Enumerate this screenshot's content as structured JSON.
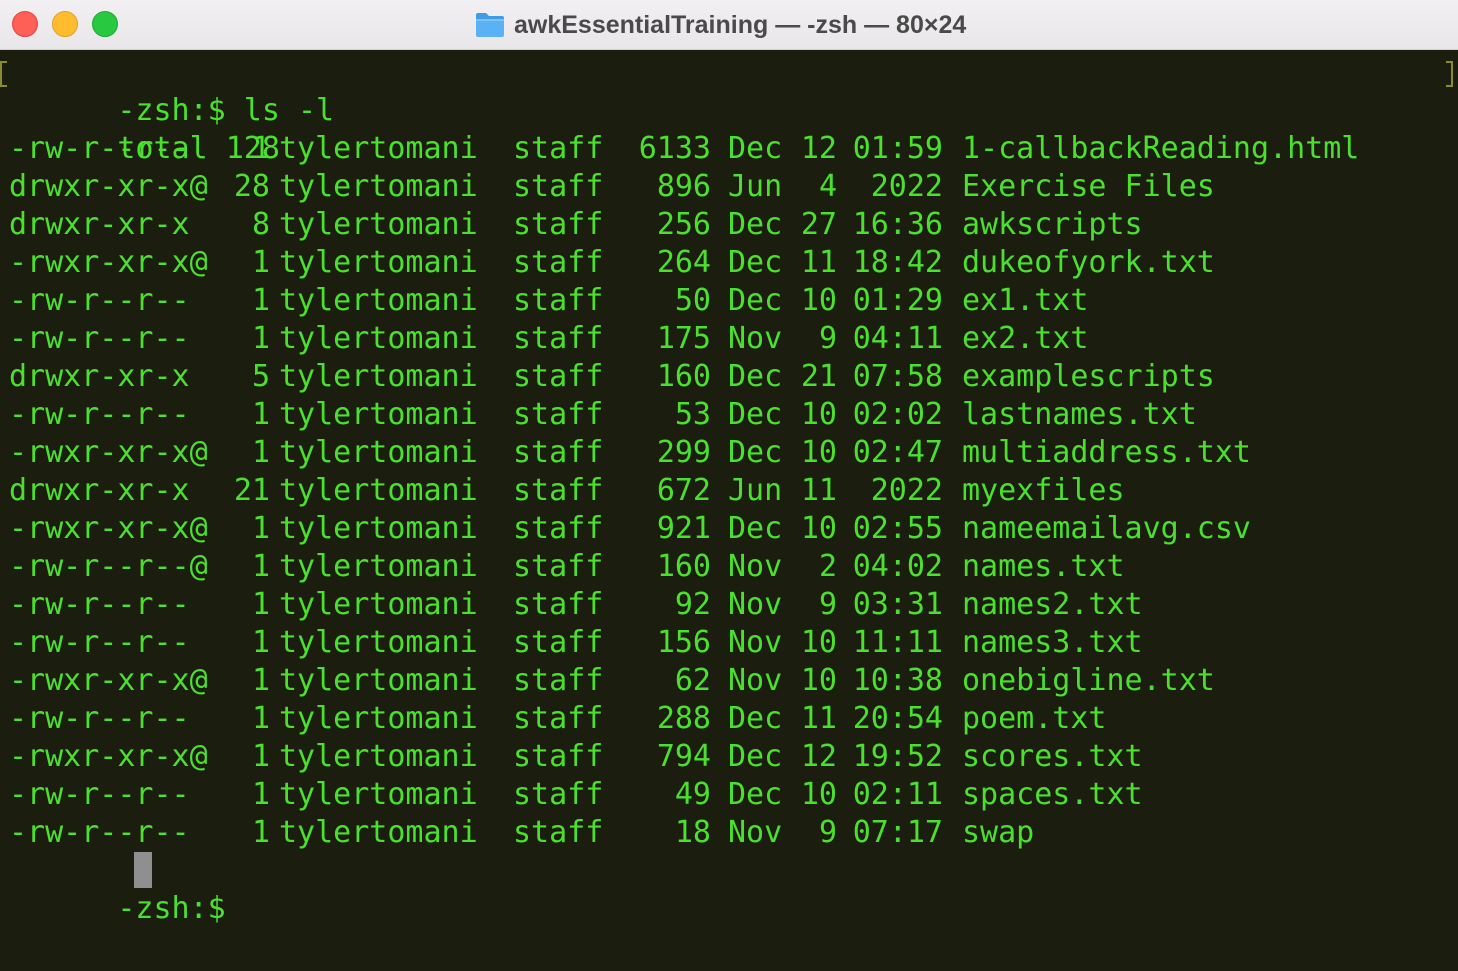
{
  "window": {
    "title": "awkEssentialTraining — -zsh — 80×24",
    "title_icon": "folder-icon",
    "colors": {
      "terminal_bg": "#1b1e0e",
      "terminal_fg": "#4be02e",
      "cursor": "#8f8f8f"
    }
  },
  "terminal": {
    "command_line": "-zsh:$ ls -l",
    "total_line": "total 128",
    "entries": [
      {
        "perm": "-rw-r--r--",
        "links": "1",
        "owner": "tylertomani",
        "group": "staff",
        "size": "6133",
        "month": "Dec",
        "day": "12",
        "time": "01:59",
        "name": "1-callbackReading.html"
      },
      {
        "perm": "drwxr-xr-x@",
        "links": "28",
        "owner": "tylertomani",
        "group": "staff",
        "size": "896",
        "month": "Jun",
        "day": "4",
        "time": "2022",
        "name": "Exercise Files"
      },
      {
        "perm": "drwxr-xr-x",
        "links": "8",
        "owner": "tylertomani",
        "group": "staff",
        "size": "256",
        "month": "Dec",
        "day": "27",
        "time": "16:36",
        "name": "awkscripts"
      },
      {
        "perm": "-rwxr-xr-x@",
        "links": "1",
        "owner": "tylertomani",
        "group": "staff",
        "size": "264",
        "month": "Dec",
        "day": "11",
        "time": "18:42",
        "name": "dukeofyork.txt"
      },
      {
        "perm": "-rw-r--r--",
        "links": "1",
        "owner": "tylertomani",
        "group": "staff",
        "size": "50",
        "month": "Dec",
        "day": "10",
        "time": "01:29",
        "name": "ex1.txt"
      },
      {
        "perm": "-rw-r--r--",
        "links": "1",
        "owner": "tylertomani",
        "group": "staff",
        "size": "175",
        "month": "Nov",
        "day": "9",
        "time": "04:11",
        "name": "ex2.txt"
      },
      {
        "perm": "drwxr-xr-x",
        "links": "5",
        "owner": "tylertomani",
        "group": "staff",
        "size": "160",
        "month": "Dec",
        "day": "21",
        "time": "07:58",
        "name": "examplescripts"
      },
      {
        "perm": "-rw-r--r--",
        "links": "1",
        "owner": "tylertomani",
        "group": "staff",
        "size": "53",
        "month": "Dec",
        "day": "10",
        "time": "02:02",
        "name": "lastnames.txt"
      },
      {
        "perm": "-rwxr-xr-x@",
        "links": "1",
        "owner": "tylertomani",
        "group": "staff",
        "size": "299",
        "month": "Dec",
        "day": "10",
        "time": "02:47",
        "name": "multiaddress.txt"
      },
      {
        "perm": "drwxr-xr-x",
        "links": "21",
        "owner": "tylertomani",
        "group": "staff",
        "size": "672",
        "month": "Jun",
        "day": "11",
        "time": "2022",
        "name": "myexfiles"
      },
      {
        "perm": "-rwxr-xr-x@",
        "links": "1",
        "owner": "tylertomani",
        "group": "staff",
        "size": "921",
        "month": "Dec",
        "day": "10",
        "time": "02:55",
        "name": "nameemailavg.csv"
      },
      {
        "perm": "-rw-r--r--@",
        "links": "1",
        "owner": "tylertomani",
        "group": "staff",
        "size": "160",
        "month": "Nov",
        "day": "2",
        "time": "04:02",
        "name": "names.txt"
      },
      {
        "perm": "-rw-r--r--",
        "links": "1",
        "owner": "tylertomani",
        "group": "staff",
        "size": "92",
        "month": "Nov",
        "day": "9",
        "time": "03:31",
        "name": "names2.txt"
      },
      {
        "perm": "-rw-r--r--",
        "links": "1",
        "owner": "tylertomani",
        "group": "staff",
        "size": "156",
        "month": "Nov",
        "day": "10",
        "time": "11:11",
        "name": "names3.txt"
      },
      {
        "perm": "-rwxr-xr-x@",
        "links": "1",
        "owner": "tylertomani",
        "group": "staff",
        "size": "62",
        "month": "Nov",
        "day": "10",
        "time": "10:38",
        "name": "onebigline.txt"
      },
      {
        "perm": "-rw-r--r--",
        "links": "1",
        "owner": "tylertomani",
        "group": "staff",
        "size": "288",
        "month": "Dec",
        "day": "11",
        "time": "20:54",
        "name": "poem.txt"
      },
      {
        "perm": "-rwxr-xr-x@",
        "links": "1",
        "owner": "tylertomani",
        "group": "staff",
        "size": "794",
        "month": "Dec",
        "day": "12",
        "time": "19:52",
        "name": "scores.txt"
      },
      {
        "perm": "-rw-r--r--",
        "links": "1",
        "owner": "tylertomani",
        "group": "staff",
        "size": "49",
        "month": "Dec",
        "day": "10",
        "time": "02:11",
        "name": "spaces.txt"
      },
      {
        "perm": "-rw-r--r--",
        "links": "1",
        "owner": "tylertomani",
        "group": "staff",
        "size": "18",
        "month": "Nov",
        "day": "9",
        "time": "07:17",
        "name": "swap"
      }
    ],
    "prompt": "-zsh:$"
  }
}
